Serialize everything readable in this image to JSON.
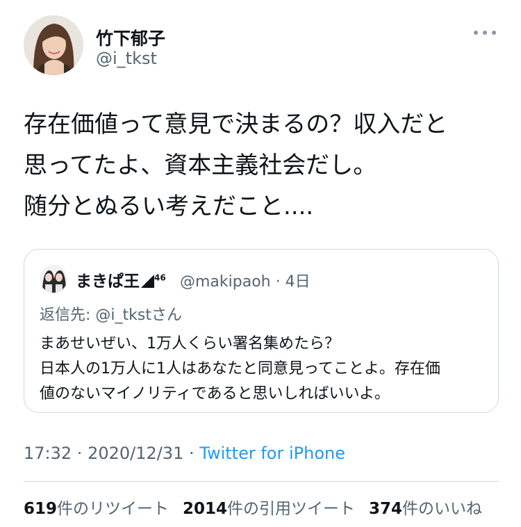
{
  "author": {
    "display_name": "竹下郁子",
    "handle": "@i_tkst"
  },
  "tweet": {
    "lines": [
      "存在価値って意見で決まるの？収入だと",
      "思ってたよ、資本主義社会だし。",
      "随分とぬるい考えだこと...."
    ],
    "time": "17:32",
    "sep1": " · ",
    "date": "2020/12/31",
    "sep2": " · ",
    "source": "Twitter for iPhone"
  },
  "quoted": {
    "display_name": "まきぱ王",
    "badge_text": "46",
    "handle_time": "@makipaoh · 4日",
    "reply_to": "返信先: @i_tkstさん",
    "lines": [
      "まあせいぜい、1万人くらい署名集めたら？",
      "日本人の1万人に1人はあなたと同意見ってことよ。存在価",
      "値のないマイノリティであると思いしればいいよ。"
    ]
  },
  "stats": {
    "retweets_count": "619",
    "retweets_label": "件のリツイート",
    "quotes_count": "2014",
    "quotes_label": "件の引用ツイート",
    "likes_count": "374",
    "likes_label": "件のいいね"
  },
  "colors": {
    "text": "#0f1419",
    "secondary": "#536471",
    "link": "#1d9bf0",
    "border": "#cfd9de"
  },
  "icons": {
    "more": "more-horizontal-icon"
  }
}
